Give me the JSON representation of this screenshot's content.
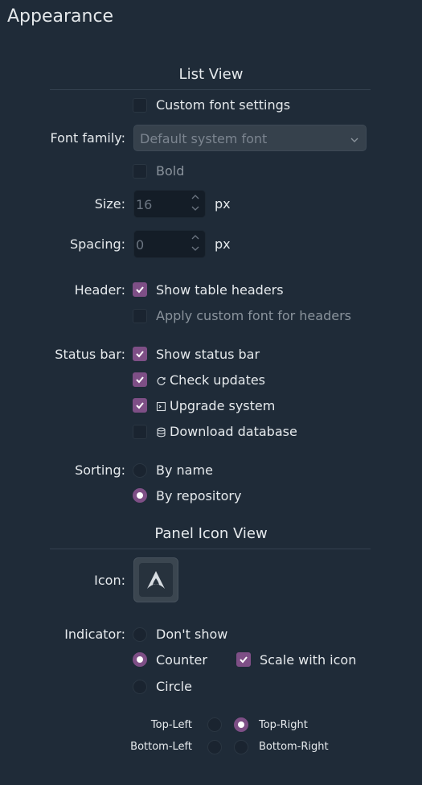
{
  "page_title": "Appearance",
  "list_view": {
    "title": "List View",
    "custom_font_label": "Custom font settings",
    "font_family_label": "Font family:",
    "font_family_value": "Default system font",
    "bold_label": "Bold",
    "size_label": "Size:",
    "size_value": "16",
    "size_unit": "px",
    "spacing_label": "Spacing:",
    "spacing_value": "0",
    "spacing_unit": "px",
    "header_label": "Header:",
    "show_headers_label": "Show table headers",
    "apply_font_headers_label": "Apply custom font for headers",
    "status_bar_label": "Status bar:",
    "show_status_bar_label": "Show status bar",
    "check_updates_label": "Check updates",
    "upgrade_system_label": "Upgrade system",
    "download_database_label": "Download database",
    "sorting_label": "Sorting:",
    "by_name_label": "By name",
    "by_repository_label": "By repository"
  },
  "panel_icon_view": {
    "title": "Panel Icon View",
    "icon_label": "Icon:",
    "indicator_label": "Indicator:",
    "dont_show_label": "Don't show",
    "counter_label": "Counter",
    "scale_with_icon_label": "Scale with icon",
    "circle_label": "Circle",
    "top_left_label": "Top-Left",
    "top_right_label": "Top-Right",
    "bottom_left_label": "Bottom-Left",
    "bottom_right_label": "Bottom-Right"
  },
  "state": {
    "custom_font": false,
    "bold": false,
    "show_headers": true,
    "apply_font_headers": false,
    "show_status_bar": true,
    "check_updates": true,
    "upgrade_system": true,
    "download_database": false,
    "sorting": "By repository",
    "indicator": "Counter",
    "scale_with_icon": true,
    "position": "Top-Right"
  },
  "colors": {
    "background": "#1f2b38",
    "accent": "#7e4f86"
  },
  "icons": [
    "chevron-down-icon",
    "spin-up-icon",
    "spin-down-icon",
    "refresh-icon",
    "upgrade-icon",
    "database-icon",
    "arch-logo-icon"
  ]
}
